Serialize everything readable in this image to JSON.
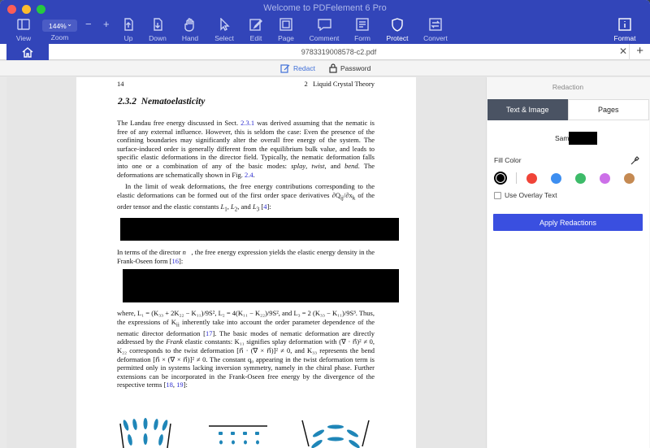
{
  "window": {
    "title": "Welcome to PDFelement 6 Pro"
  },
  "toolbar": {
    "view": "View",
    "zoom_value": "144%",
    "zoom_label": "Zoom",
    "up": "Up",
    "down": "Down",
    "hand": "Hand",
    "select": "Select",
    "edit": "Edit",
    "page": "Page",
    "comment": "Comment",
    "form": "Form",
    "protect": "Protect",
    "convert": "Convert",
    "format": "Format"
  },
  "tabs": {
    "document_name": "9783319008578-c2.pdf"
  },
  "subbar": {
    "redact": "Redact",
    "password": "Password"
  },
  "page": {
    "header_left": "14",
    "header_right": "2   Liquid Crystal Theory",
    "section": "2.3.2  Nematoelasticity",
    "p1": [
      "The Landau free energy discussed in Sect. ",
      "2.3.1",
      " was derived assuming that the nematic is free of any external influence. However, this is seldom the case: Even the presence of the confining boundaries may significantly alter the overall free energy of the system. The surface-induced order is generally different from the equilibrium bulk value, and leads to specific elastic deformations in the director field. Typically, the nematic deformation falls into one or a combination of any of the basic modes: ",
      "splay",
      ", ",
      "twist",
      ", and ",
      "bend",
      ". The deformations are schematically shown in Fig. ",
      "2.4",
      "."
    ],
    "p2": [
      "In the limit of weak deformations, the free energy contributions corresponding to the elastic deformations can be formed out of the first order space derivatives ∂Q",
      "ij",
      "/∂x",
      "k",
      " of the order tensor and the elastic constants ",
      "L",
      "1",
      ", ",
      "L",
      "2",
      ", and ",
      "L",
      "3",
      " [",
      "4",
      "]:"
    ],
    "p3": [
      "In terms of the director ",
      "n⃗",
      ", the free energy expression yields the elastic energy density in the Frank-Oseen form [",
      "16",
      "]:"
    ],
    "p4": [
      "where, L₁ = (K₃₃ + 2K₂₂ − K₁₁)/9S², L₂ = 4(K₁₁ − K₂₂)/9S², and L₃ = 2 (K₃₃ − K₁₁)/9S³. Thus, the expressions of K",
      "ii",
      " inherently take into account the order parameter dependence of the nematic director deformation [",
      "17",
      "]. The basic modes of nematic deformation are directly addressed by the ",
      "Frank",
      " elastic constants: K₁₁ signifies splay deformation with (∇ · n⃗)² ≠ 0, K₂₂ corresponds to the twist deformation [n⃗ · (∇ × n⃗)]² ≠ 0, and K₃₃ represents the bend deformation [n⃗ × (∇ × n⃗)]² ≠ 0. The constant q₀ appearing in the twist deformation term is permitted only in systems lacking inversion symmetry, namely in the chiral phase. Further extensions can be incorporated in the Frank-Oseen free energy by the divergence of the respective terms [",
      "18",
      ", ",
      "19",
      "]:"
    ]
  },
  "panel": {
    "title": "Redaction",
    "tab_text_image": "Text & Image",
    "tab_pages": "Pages",
    "sample_text": "Sam",
    "fill_color": "Fill Color",
    "overlay_text": "Use Overlay Text",
    "apply": "Apply Redactions",
    "colors": [
      "#000000",
      "#f04438",
      "#3d8ef0",
      "#3dbb69",
      "#cc70e8",
      "#c58a52"
    ]
  }
}
